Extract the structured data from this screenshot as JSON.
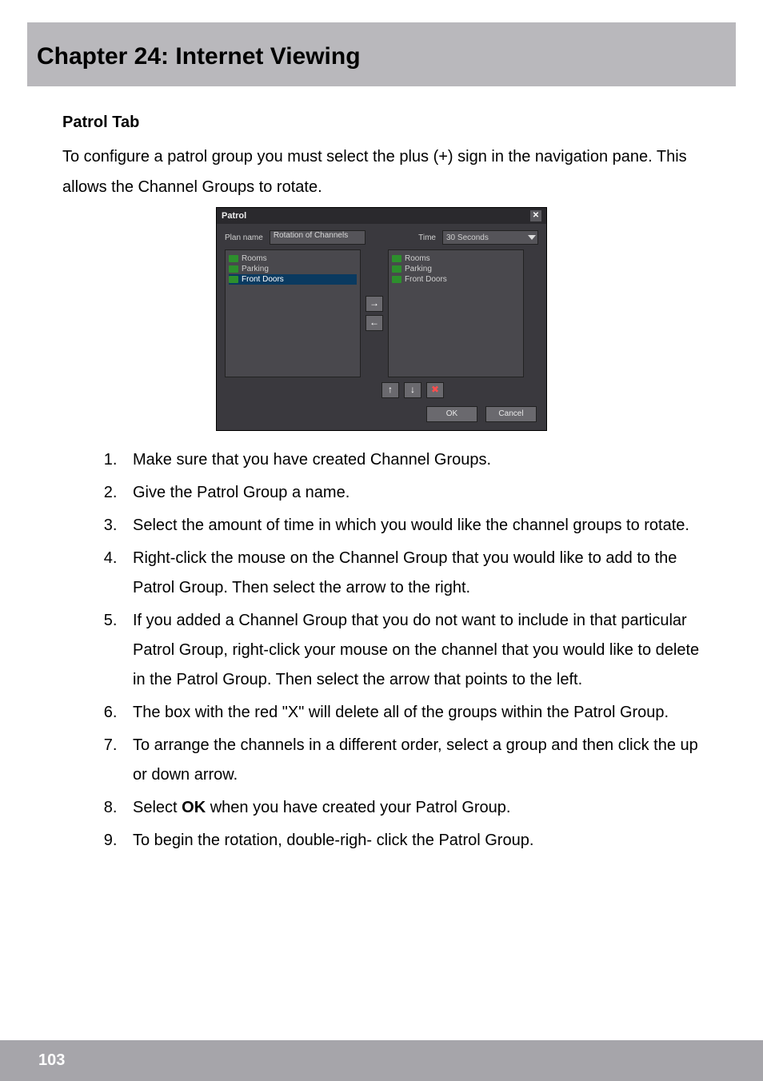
{
  "chapter_title": "Chapter 24: Internet Viewing",
  "section_title": "Patrol Tab",
  "intro_text": "To configure a patrol group you must select the plus (+) sign in the navigation pane. This allows the Channel Groups to rotate.",
  "steps": [
    "Make sure that you have created Channel Groups.",
    "Give the Patrol Group a name.",
    "Select the amount of time in which you would like the channel groups to rotate.",
    "Right-click the mouse on the Channel Group that you would like to add to the Patrol Group. Then select the arrow to the right.",
    "If you added a Channel Group that you do not want to include in that particular Patrol Group, right-click your mouse on the channel that you would like to delete in the Patrol Group. Then select the arrow that points to the left.",
    "The box with the red \"X\" will delete all of the groups within the Patrol Group.",
    "To arrange the channels in a different order, select a group and then click the up or down arrow.",
    {
      "pre": "Select ",
      "bold": "OK",
      "post": " when you have created your Patrol Group."
    },
    "To begin the rotation, double-righ- click the Patrol Group."
  ],
  "page_number": "103",
  "dialog": {
    "title": "Patrol",
    "close": "✕",
    "plan_label": "Plan name",
    "plan_value": "Rotation of Channels",
    "time_label": "Time",
    "time_value": "30 Seconds",
    "left_list": [
      {
        "label": "Rooms",
        "selected": false
      },
      {
        "label": "Parking",
        "selected": false
      },
      {
        "label": "Front Doors",
        "selected": true
      }
    ],
    "right_list": [
      {
        "label": "Rooms"
      },
      {
        "label": "Parking"
      },
      {
        "label": "Front Doors"
      }
    ],
    "arrow_right": "→",
    "arrow_left": "←",
    "arrow_up": "↑",
    "arrow_down": "↓",
    "delete_all": "✖",
    "ok": "OK",
    "cancel": "Cancel"
  }
}
